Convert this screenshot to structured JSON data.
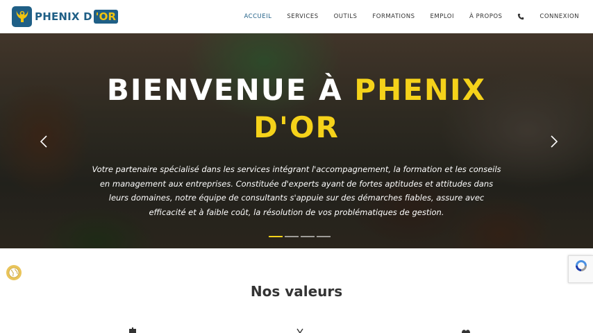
{
  "header": {
    "logo": {
      "brand": "PHENIX D",
      "brand_or": "'OR"
    },
    "nav": [
      {
        "label": "ACCUEIL",
        "active": true
      },
      {
        "label": "SERVICES"
      },
      {
        "label": "OUTILS"
      },
      {
        "label": "FORMATIONS"
      },
      {
        "label": "EMPLOI"
      },
      {
        "label": "À PROPOS"
      }
    ],
    "phone_icon": "phone-icon",
    "login_label": "CONNEXION"
  },
  "hero": {
    "title_white": "BIENVENUE À ",
    "title_gold_1": "PHENIX",
    "title_gold_2": "D'OR",
    "text": "Votre partenaire spécialisé dans les services intégrant l'accompagnement, la formation et les conseils en management aux entreprises. Constituée d'experts ayant de fortes aptitudes et attitudes dans leurs domaines, notre équipe de consultants s'appuie sur des démarches fiables, assure avec efficacité et à faible coût, la résolution de vos problématiques de gestion.",
    "slides": 4,
    "active_slide": 1,
    "accent": "#f5d21a"
  },
  "values": {
    "title": "Nos valeurs"
  },
  "colors": {
    "brand": "#1f5f86",
    "gold": "#f5d21a"
  }
}
